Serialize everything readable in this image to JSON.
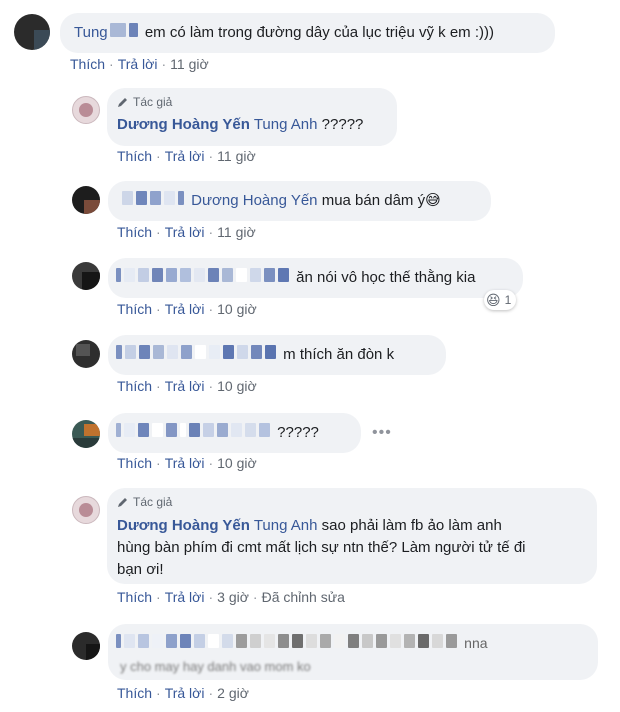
{
  "comments": [
    {
      "text": "em có làm trong đường dây của lục triệu vỹ k em :)))",
      "partial_name": "Tung"
    },
    {
      "author_badge": "Tác giả",
      "name": "Dương Hoàng Yến",
      "mention": "Tung Anh",
      "text": "?????"
    },
    {
      "mention": "Dương Hoàng Yến",
      "text": "mua bán dâm ý",
      "emoji": "😅"
    },
    {
      "text": "ăn nói vô học thế thằng kia",
      "reaction_emoji": "😆",
      "reaction_count": "1"
    },
    {
      "text": "m thích ăn đòn k"
    },
    {
      "text": "?????",
      "more": "•••"
    },
    {
      "author_badge": "Tác giả",
      "name": "Dương Hoàng Yến",
      "mention": "Tung Anh",
      "text_lines": [
        "sao phải làm fb ảo làm anh",
        "hùng bàn phím đi cmt mất lịch sự ntn thế? Làm người tử tế đi",
        "bạn ơi!"
      ]
    },
    {
      "text_fragment_1": "nna",
      "text_fragment_2": "y cho may  hay danh vao mom ko"
    }
  ],
  "actions": {
    "like": "Thích",
    "reply": "Trả lời",
    "edited": "Đã chỉnh sửa",
    "times": [
      "11 giờ",
      "11 giờ",
      "11 giờ",
      "10 giờ",
      "10 giờ",
      "10 giờ",
      "3 giờ",
      "2 giờ"
    ]
  },
  "colors": {
    "link": "#385898",
    "bubble": "#f0f2f5",
    "meta": "#606770"
  }
}
